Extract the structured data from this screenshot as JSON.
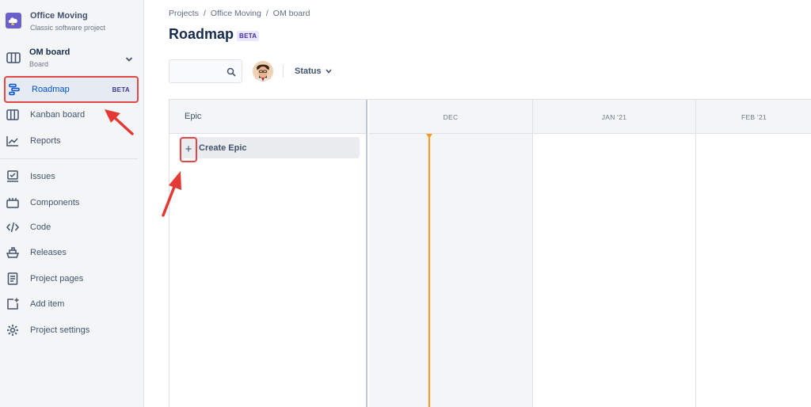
{
  "project": {
    "name": "Office Moving",
    "type": "Classic software project"
  },
  "board": {
    "name": "OM board",
    "subtitle": "Board"
  },
  "sidebar": {
    "items": [
      {
        "label": "Roadmap",
        "badge": "BETA"
      },
      {
        "label": "Kanban board"
      },
      {
        "label": "Reports"
      },
      {
        "label": "Issues"
      },
      {
        "label": "Components"
      },
      {
        "label": "Code"
      },
      {
        "label": "Releases"
      },
      {
        "label": "Project pages"
      },
      {
        "label": "Add item"
      },
      {
        "label": "Project settings"
      }
    ]
  },
  "breadcrumb": {
    "items": [
      "Projects",
      "Office Moving",
      "OM board"
    ],
    "separator": "/"
  },
  "header": {
    "title": "Roadmap",
    "badge": "BETA"
  },
  "toolbar": {
    "search_placeholder": "",
    "status_label": "Status"
  },
  "roadmap": {
    "epic_header": "Epic",
    "create_label": "Create Epic",
    "months": [
      "DEC",
      "JAN '21",
      "FEB '21"
    ]
  },
  "colors": {
    "accent": "#0052cc",
    "today": "#ff991f",
    "highlight": "#e04848",
    "beta": "#403294"
  },
  "icons": [
    "project-avatar-icon",
    "board-icon",
    "chevron-down-icon",
    "roadmap-icon",
    "kanban-icon",
    "reports-icon",
    "issues-icon",
    "components-icon",
    "code-icon",
    "releases-icon",
    "pages-icon",
    "add-item-icon",
    "settings-icon",
    "search-icon",
    "plus-icon"
  ]
}
